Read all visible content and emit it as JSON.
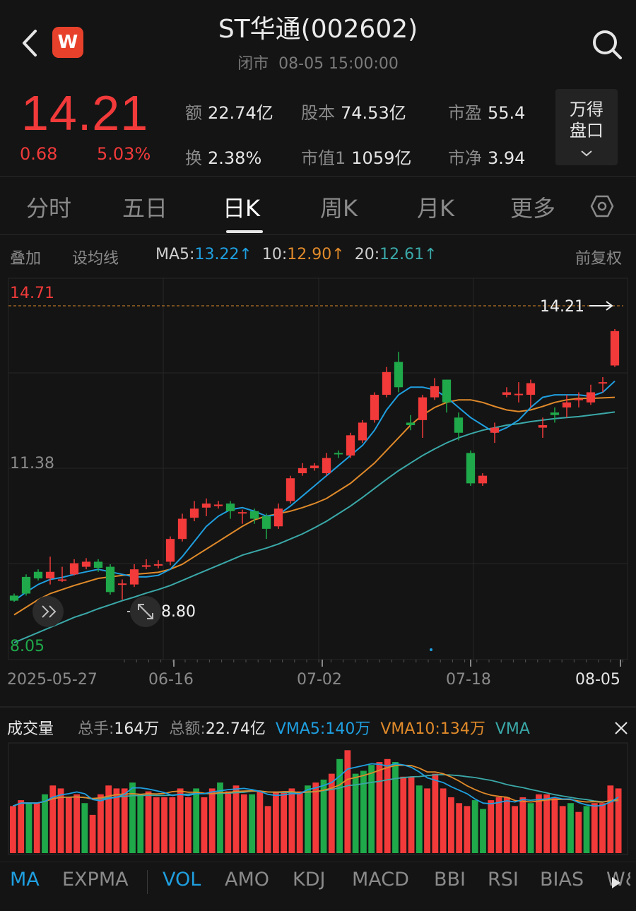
{
  "header": {
    "title": "ST华通(002602)",
    "status": "闭市",
    "datetime": "08-05 15:00:00",
    "app_icon_letter": "W"
  },
  "quote": {
    "price": "14.21",
    "change": "0.68",
    "change_pct": "5.03%",
    "stats": [
      {
        "key": "额",
        "value": "22.74亿"
      },
      {
        "key": "股本",
        "value": "74.53亿"
      },
      {
        "key": "市盈",
        "value": "55.4"
      },
      {
        "key": "换",
        "value": "2.38%"
      },
      {
        "key": "市值1",
        "value": "1059亿"
      },
      {
        "key": "市净",
        "value": "3.94"
      }
    ],
    "pankou_line1": "万得",
    "pankou_line2": "盘口",
    "up_color": "#f23a3a",
    "down_color": "#1fa94a"
  },
  "tabs": [
    "分时",
    "五日",
    "日K",
    "周K",
    "月K",
    "更多"
  ],
  "active_tab": "日K",
  "ma_bar": {
    "overlay": "叠加",
    "set_ma": "设均线",
    "ma5_label": "MA5:",
    "ma5_value": "13.22↑",
    "ma10_label": "10:",
    "ma10_value": "12.90↑",
    "ma20_label": "20:",
    "ma20_value": "12.61↑",
    "adjust": "前复权",
    "ma5_color": "#1f9fe0",
    "ma10_color": "#e08a2a",
    "ma20_color": "#3ba8a8"
  },
  "chart_data": {
    "type": "candlestick",
    "price_max_label": "14.71",
    "price_mid_label": "11.38",
    "price_min_label": "8.05",
    "last_price_label": "14.21",
    "low_marker_label": "8.80",
    "ylim": [
      8.05,
      14.71
    ],
    "dates": [
      "2025-05-27",
      "06-16",
      "07-02",
      "07-18",
      "08-05"
    ],
    "candles": [
      [
        8.98,
        8.88,
        9.02,
        8.86
      ],
      [
        9.35,
        9.02,
        9.4,
        8.98
      ],
      [
        9.45,
        9.32,
        9.5,
        9.28
      ],
      [
        9.32,
        9.45,
        9.75,
        9.2
      ],
      [
        9.28,
        9.3,
        9.55,
        9.25
      ],
      [
        9.4,
        9.62,
        9.7,
        9.38
      ],
      [
        9.55,
        9.65,
        9.72,
        9.5
      ],
      [
        9.65,
        9.53,
        9.7,
        9.45
      ],
      [
        9.55,
        9.05,
        9.6,
        9.0
      ],
      [
        9.2,
        9.22,
        9.3,
        8.9
      ],
      [
        9.2,
        9.5,
        9.6,
        9.15
      ],
      [
        9.55,
        9.58,
        9.7,
        9.5
      ],
      [
        9.58,
        9.6,
        9.68,
        9.52
      ],
      [
        9.65,
        10.1,
        10.15,
        9.58
      ],
      [
        10.1,
        10.5,
        10.6,
        10.05
      ],
      [
        10.52,
        10.7,
        10.85,
        10.45
      ],
      [
        10.72,
        10.8,
        10.9,
        10.55
      ],
      [
        10.75,
        10.78,
        10.85,
        10.7
      ],
      [
        10.8,
        10.65,
        10.85,
        10.5
      ],
      [
        10.62,
        10.63,
        10.68,
        10.4
      ],
      [
        10.65,
        10.5,
        10.7,
        10.4
      ],
      [
        10.55,
        10.3,
        10.6,
        10.1
      ],
      [
        10.35,
        10.7,
        10.8,
        10.3
      ],
      [
        10.85,
        11.3,
        11.35,
        10.8
      ],
      [
        11.4,
        11.5,
        11.6,
        11.35
      ],
      [
        11.5,
        11.55,
        11.6,
        11.45
      ],
      [
        11.4,
        11.7,
        11.8,
        11.35
      ],
      [
        11.8,
        11.78,
        11.85,
        11.7
      ],
      [
        11.75,
        12.15,
        12.2,
        11.7
      ],
      [
        12.05,
        12.4,
        12.45,
        12.0
      ],
      [
        12.45,
        12.95,
        13.0,
        12.4
      ],
      [
        12.95,
        13.4,
        13.5,
        12.9
      ],
      [
        13.6,
        13.1,
        13.8,
        13.0
      ],
      [
        12.4,
        12.35,
        12.55,
        12.25
      ],
      [
        12.45,
        12.9,
        12.95,
        12.1
      ],
      [
        12.9,
        13.12,
        13.28,
        12.85
      ],
      [
        13.25,
        12.8,
        13.25,
        12.6
      ],
      [
        12.5,
        12.2,
        12.6,
        12.05
      ],
      [
        11.8,
        11.2,
        11.85,
        11.15
      ],
      [
        11.2,
        11.35,
        11.4,
        11.15
      ],
      [
        12.2,
        12.3,
        12.4,
        12.0
      ],
      [
        12.95,
        13.0,
        13.1,
        12.9
      ],
      [
        12.95,
        12.97,
        13.2,
        12.8
      ],
      [
        12.95,
        13.18,
        13.25,
        12.7
      ],
      [
        12.3,
        12.35,
        12.5,
        12.1
      ],
      [
        12.6,
        12.55,
        12.7,
        12.4
      ],
      [
        12.7,
        12.8,
        12.95,
        12.5
      ],
      [
        12.85,
        12.87,
        13.0,
        12.7
      ],
      [
        12.8,
        13.0,
        13.15,
        12.75
      ],
      [
        13.2,
        13.2,
        13.3,
        13.0
      ],
      [
        13.53,
        14.21,
        14.25,
        13.5
      ]
    ],
    "ma5": [
      8.88,
      9.05,
      9.2,
      9.3,
      9.34,
      9.4,
      9.45,
      9.5,
      9.45,
      9.4,
      9.35,
      9.35,
      9.38,
      9.5,
      9.75,
      10.05,
      10.35,
      10.55,
      10.68,
      10.72,
      10.65,
      10.55,
      10.58,
      10.75,
      10.95,
      11.15,
      11.35,
      11.55,
      11.75,
      11.95,
      12.25,
      12.65,
      12.95,
      13.1,
      13.1,
      13.05,
      12.9,
      12.7,
      12.5,
      12.35,
      12.2,
      12.3,
      12.45,
      12.7,
      12.9,
      12.95,
      12.95,
      12.95,
      12.92,
      13.0,
      13.22
    ],
    "ma10": [
      8.6,
      8.75,
      8.9,
      9.02,
      9.1,
      9.18,
      9.25,
      9.32,
      9.35,
      9.38,
      9.4,
      9.42,
      9.44,
      9.5,
      9.6,
      9.75,
      9.9,
      10.05,
      10.2,
      10.35,
      10.48,
      10.55,
      10.6,
      10.65,
      10.72,
      10.8,
      10.9,
      11.05,
      11.2,
      11.4,
      11.6,
      11.85,
      12.1,
      12.35,
      12.55,
      12.7,
      12.8,
      12.85,
      12.85,
      12.8,
      12.72,
      12.65,
      12.62,
      12.65,
      12.72,
      12.8,
      12.85,
      12.88,
      12.88,
      12.89,
      12.9
    ],
    "ma20": [
      8.05,
      8.15,
      8.25,
      8.35,
      8.45,
      8.55,
      8.63,
      8.72,
      8.8,
      8.88,
      8.95,
      9.03,
      9.1,
      9.18,
      9.28,
      9.38,
      9.48,
      9.58,
      9.68,
      9.78,
      9.85,
      9.92,
      10.0,
      10.1,
      10.2,
      10.32,
      10.45,
      10.6,
      10.75,
      10.92,
      11.1,
      11.28,
      11.45,
      11.6,
      11.75,
      11.88,
      12.0,
      12.1,
      12.18,
      12.25,
      12.3,
      12.35,
      12.38,
      12.42,
      12.45,
      12.48,
      12.5,
      12.52,
      12.55,
      12.58,
      12.61
    ]
  },
  "volume": {
    "title": "成交量",
    "total_hands_label": "总手:",
    "total_hands": "164万",
    "total_amount_label": "总额:",
    "total_amount": "22.74亿",
    "vma5_label": "VMA5:",
    "vma5": "140万",
    "vma10_label": "VMA10:",
    "vma10": "134万",
    "vma20_label": "VMA",
    "bars": [
      80,
      90,
      85,
      85,
      100,
      115,
      110,
      95,
      100,
      85,
      65,
      100,
      115,
      110,
      110,
      120,
      100,
      105,
      95,
      95,
      95,
      110,
      95,
      110,
      95,
      110,
      120,
      105,
      115,
      100,
      100,
      105,
      80,
      105,
      105,
      110,
      105,
      115,
      120,
      125,
      135,
      160,
      175,
      135,
      140,
      150,
      155,
      160,
      155,
      130,
      130,
      115,
      110,
      135,
      110,
      95,
      85,
      80,
      90,
      75,
      90,
      95,
      95,
      80,
      95,
      85,
      100,
      100,
      95,
      80,
      85,
      70,
      80,
      85,
      85,
      115,
      110
    ]
  },
  "bottom_tabs": [
    "MA",
    "EXPMA",
    "VOL",
    "AMO",
    "KDJ",
    "MACD",
    "BBI",
    "RSI",
    "BIAS",
    "W&"
  ],
  "active_bottom": [
    "MA",
    "VOL"
  ]
}
